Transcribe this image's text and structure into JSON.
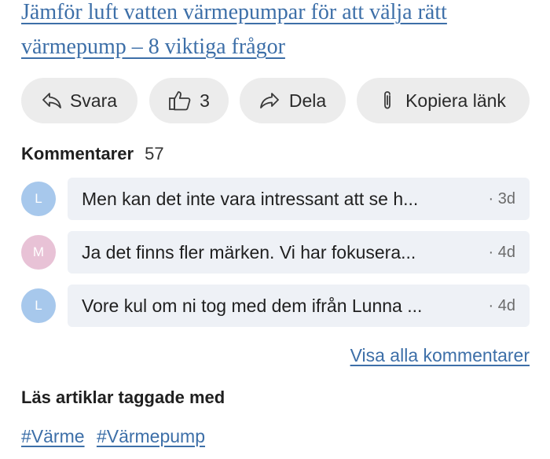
{
  "article": {
    "title": "Jämför luft vatten värmepumpar för att välja rätt värmepump – 8 viktiga frågor"
  },
  "actions": {
    "reply_label": "Svara",
    "like_count": "3",
    "share_label": "Dela",
    "copy_link_label": "Kopiera länk",
    "icons": [
      "reply-icon",
      "thumbs-up-icon",
      "share-icon",
      "paperclip-icon"
    ]
  },
  "comments": {
    "heading": "Kommentarer",
    "count": "57",
    "items": [
      {
        "initial": "L",
        "avatar_color": "#a7c8ec",
        "text": "Men kan det inte vara intressant att se h...",
        "time": "· 3d"
      },
      {
        "initial": "M",
        "avatar_color": "#e8c2d6",
        "text": "Ja det finns fler märken. Vi har fokusera...",
        "time": "· 4d"
      },
      {
        "initial": "L",
        "avatar_color": "#a7c8ec",
        "text": "Vore kul om ni tog med dem ifrån Lunna ...",
        "time": "· 4d"
      }
    ],
    "show_all_label": "Visa alla kommentarer"
  },
  "tags": {
    "heading": "Läs artiklar taggade med",
    "items": [
      "#Värme",
      "#Värmepump"
    ]
  },
  "colors": {
    "link": "#3d6fa8",
    "pill_bg": "#ececec",
    "bubble_bg": "#eef1f6"
  }
}
